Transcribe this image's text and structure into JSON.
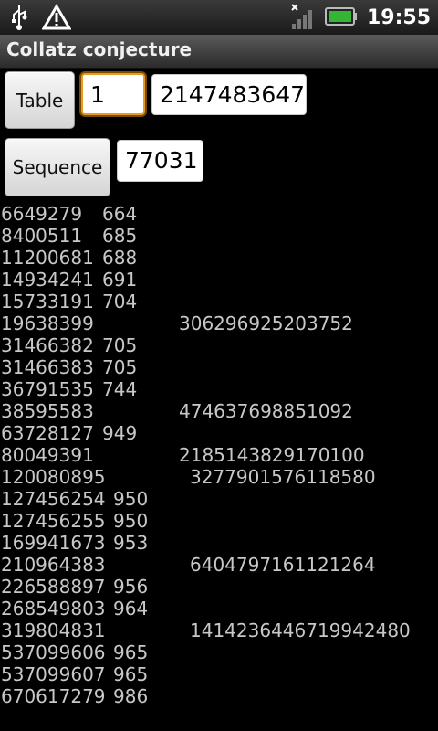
{
  "status_bar": {
    "icons": [
      "usb-icon",
      "warning-icon",
      "no-data-signal-icon",
      "battery-icon"
    ],
    "time": "19:55"
  },
  "title_bar": {
    "title": "Collatz conjecture"
  },
  "controls": {
    "table_button_label": "Table",
    "table_start_value": "1",
    "table_end_value": "2147483647",
    "sequence_button_label": "Sequence",
    "sequence_value": "77031"
  },
  "results": {
    "rows": [
      {
        "number": "6649279",
        "steps": "664",
        "peak": ""
      },
      {
        "number": "8400511",
        "steps": "685",
        "peak": ""
      },
      {
        "number": "11200681",
        "steps": "688",
        "peak": ""
      },
      {
        "number": "14934241",
        "steps": "691",
        "peak": ""
      },
      {
        "number": "15733191",
        "steps": "704",
        "peak": ""
      },
      {
        "number": "19638399",
        "steps": "",
        "peak": "306296925203752"
      },
      {
        "number": "31466382",
        "steps": "705",
        "peak": ""
      },
      {
        "number": "31466383",
        "steps": "705",
        "peak": ""
      },
      {
        "number": "36791535",
        "steps": "744",
        "peak": ""
      },
      {
        "number": "38595583",
        "steps": "",
        "peak": "474637698851092"
      },
      {
        "number": "63728127",
        "steps": "949",
        "peak": ""
      },
      {
        "number": "80049391",
        "steps": "",
        "peak": "2185143829170100"
      },
      {
        "number": "120080895",
        "steps": "",
        "peak": "3277901576118580"
      },
      {
        "number": "127456254",
        "steps": "950",
        "peak": ""
      },
      {
        "number": "127456255",
        "steps": "950",
        "peak": ""
      },
      {
        "number": "169941673",
        "steps": "953",
        "peak": ""
      },
      {
        "number": "210964383",
        "steps": "",
        "peak": "6404797161121264"
      },
      {
        "number": "226588897",
        "steps": "956",
        "peak": ""
      },
      {
        "number": "268549803",
        "steps": "964",
        "peak": ""
      },
      {
        "number": "319804831",
        "steps": "",
        "peak": "1414236446719942480"
      },
      {
        "number": "537099606",
        "steps": "965",
        "peak": ""
      },
      {
        "number": "537099607",
        "steps": "965",
        "peak": ""
      },
      {
        "number": "670617279",
        "steps": "986",
        "peak": ""
      }
    ]
  }
}
